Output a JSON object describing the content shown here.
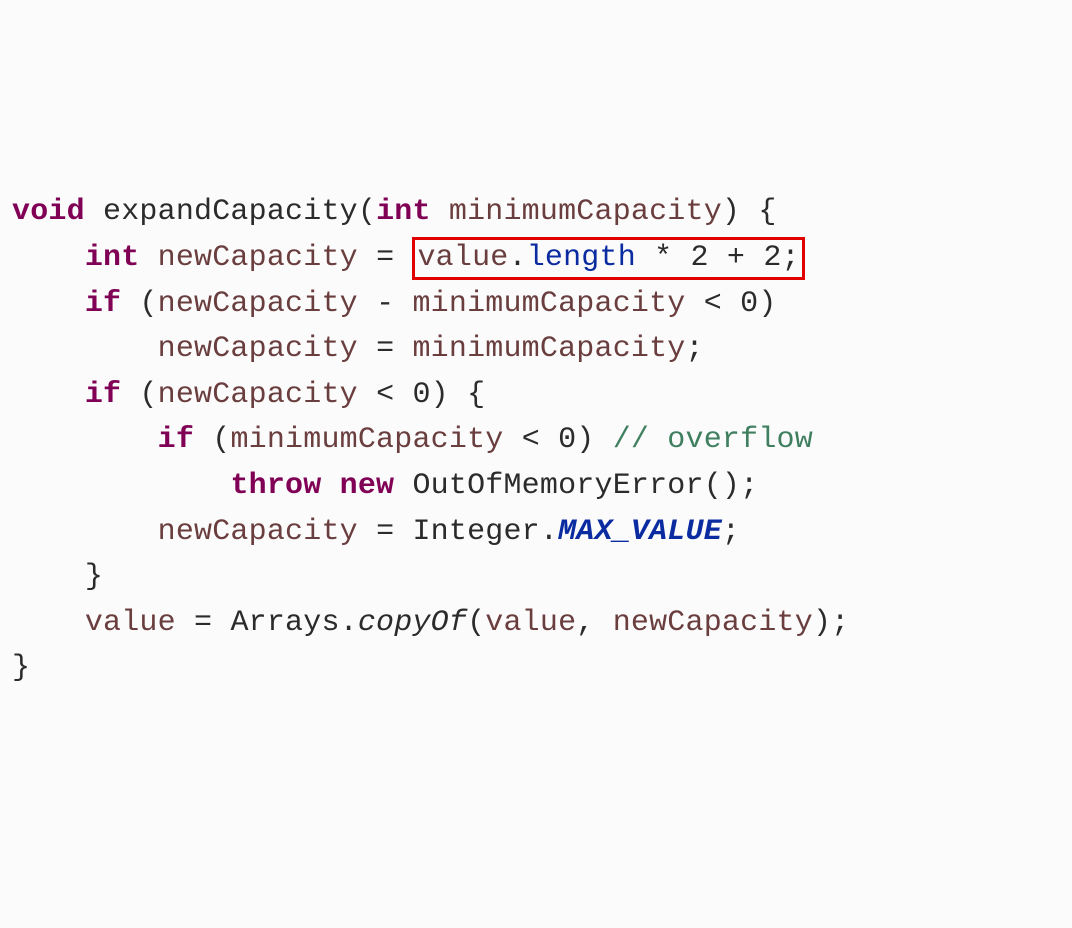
{
  "l1": {
    "kw1": "void",
    "sp1": " ",
    "m": "expandCapacity",
    "p1": "(",
    "kw2": "int",
    "sp2": " ",
    "arg": "minimumCapacity",
    "p2": ")",
    "sp3": " ",
    "br": "{"
  },
  "l2": {
    "ind": "    ",
    "kw": "int",
    "sp": " ",
    "v": "newCapacity",
    "sp2": " ",
    "eq": "=",
    "sp3": " ",
    "box": {
      "v1": "value",
      "dot": ".",
      "fld": "length",
      "rest": " * 2 + 2;"
    }
  },
  "l3": {
    "ind": "    ",
    "kw": "if",
    "sp": " ",
    "p1": "(",
    "v1": "newCapacity",
    "sp2": " ",
    "op": "-",
    "sp3": " ",
    "v2": "minimumCapacity",
    "sp4": " ",
    "lt": "<",
    "sp5": " ",
    "z": "0",
    "p2": ")"
  },
  "l4": {
    "ind": "        ",
    "v1": "newCapacity",
    "sp": " ",
    "eq": "=",
    "sp2": " ",
    "v2": "minimumCapacity",
    "sc": ";"
  },
  "l5": {
    "ind": "    ",
    "kw": "if",
    "sp": " ",
    "p1": "(",
    "v": "newCapacity",
    "sp2": " ",
    "lt": "<",
    "sp3": " ",
    "z": "0",
    "p2": ")",
    "sp4": " ",
    "br": "{"
  },
  "l6": {
    "ind": "        ",
    "kw": "if",
    "sp": " ",
    "p1": "(",
    "v": "minimumCapacity",
    "sp2": " ",
    "lt": "<",
    "sp3": " ",
    "z": "0",
    "p2": ")",
    "sp4": " ",
    "cmt": "// overflow"
  },
  "l7": {
    "ind": "            ",
    "kw1": "throw",
    "sp": " ",
    "kw2": "new",
    "sp2": " ",
    "cls": "OutOfMemoryError",
    "par": "();"
  },
  "l8": {
    "ind": "        ",
    "v": "newCapacity",
    "sp": " ",
    "eq": "=",
    "sp2": " ",
    "cls": "Integer",
    "dot": ".",
    "c": "MAX_VALUE",
    "sc": ";"
  },
  "l9": {
    "ind": "    ",
    "br": "}"
  },
  "l10": {
    "ind": "    ",
    "v1": "value",
    "sp": " ",
    "eq": "=",
    "sp2": " ",
    "cls": "Arrays",
    "dot": ".",
    "m": "copyOf",
    "p1": "(",
    "a1": "value",
    "cm": ", ",
    "a2": "newCapacity",
    "p2": ");"
  },
  "l11": {
    "br": "}"
  }
}
